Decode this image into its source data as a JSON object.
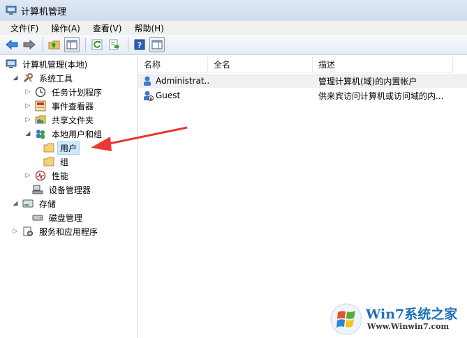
{
  "window": {
    "title": "计算机管理"
  },
  "menu": [
    "文件(F)",
    "操作(A)",
    "查看(V)",
    "帮助(H)"
  ],
  "tree": {
    "root": "计算机管理(本地)",
    "system_tools": "系统工具",
    "task_scheduler": "任务计划程序",
    "event_viewer": "事件查看器",
    "shared_folders": "共享文件夹",
    "local_users_groups": "本地用户和组",
    "users": "用户",
    "groups": "组",
    "performance": "性能",
    "device_manager": "设备管理器",
    "storage": "存储",
    "disk_management": "磁盘管理",
    "services_apps": "服务和应用程序"
  },
  "list": {
    "columns": [
      "名称",
      "全名",
      "描述"
    ],
    "rows": [
      {
        "name": "Administrat...",
        "fullname": "",
        "description": "管理计算机(域)的内置帐户"
      },
      {
        "name": "Guest",
        "fullname": "",
        "description": "供来宾访问计算机或访问域的内..."
      }
    ]
  },
  "watermark": {
    "title": "Win7系统之家",
    "url": "Www.Winwin7.com"
  },
  "colors": {
    "accent": "#2a7ad0",
    "arrow": "#e8382f",
    "selection": "#cce8ff"
  }
}
